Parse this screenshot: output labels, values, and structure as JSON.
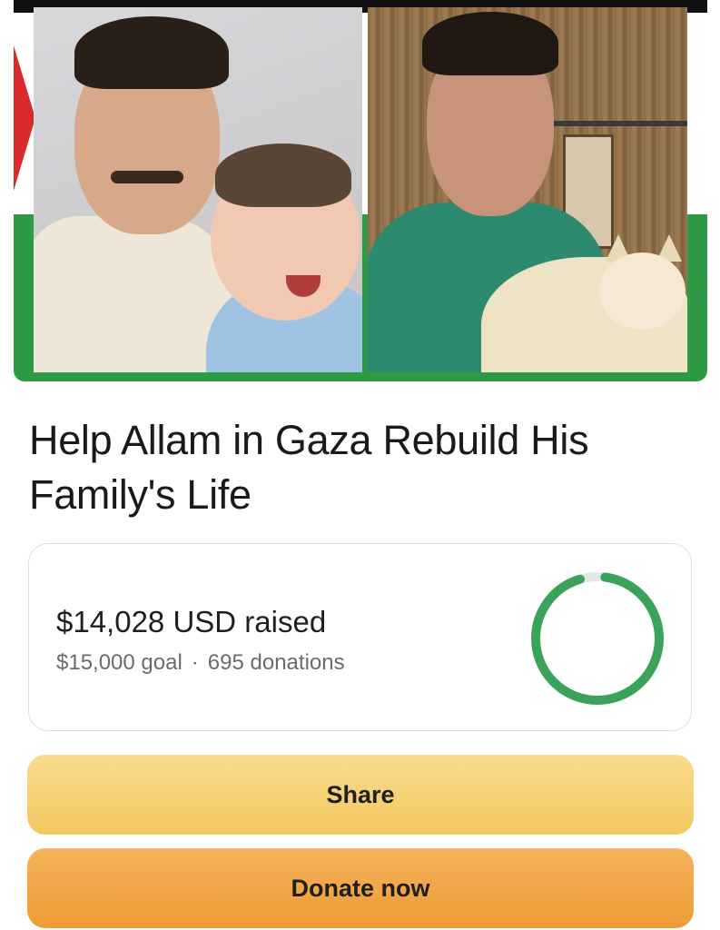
{
  "campaign": {
    "title": "Help Allam in Gaza Rebuild His Family's Life"
  },
  "progress": {
    "raised_text": "$14,028 USD raised",
    "goal_text": "$15,000 goal",
    "separator": "·",
    "donations_text": "695 donations",
    "fraction": 0.935,
    "ring_color": "#3ba25c",
    "ring_track_color": "#e6e6e6"
  },
  "actions": {
    "share_label": "Share",
    "donate_label": "Donate now"
  },
  "colors": {
    "share_button": "#f5d273",
    "donate_button": "#f2a845",
    "flag_green": "#2f9a46",
    "flag_red": "#d92b2b"
  }
}
